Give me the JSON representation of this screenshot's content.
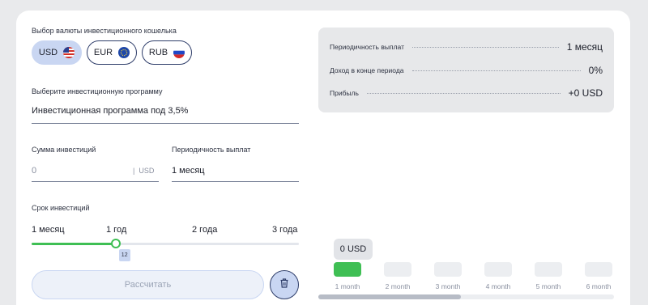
{
  "currency": {
    "label": "Выбор валюты инвестиционного кошелька",
    "options": [
      {
        "code": "USD",
        "flag": "us-flag-icon",
        "selected": true
      },
      {
        "code": "EUR",
        "flag": "eu-flag-icon",
        "selected": false
      },
      {
        "code": "RUB",
        "flag": "ru-flag-icon",
        "selected": false
      }
    ]
  },
  "program": {
    "label": "Выберите инвестиционную программу",
    "value": "Инвестиционная программа под 3,5%"
  },
  "amount": {
    "label": "Сумма инвестиций",
    "placeholder": "0",
    "unit": "USD"
  },
  "payout": {
    "label": "Периодичность выплат",
    "value": "1 месяц"
  },
  "term": {
    "label": "Срок инвестиций",
    "marks": [
      "1 месяц",
      "1 год",
      "2 года",
      "3 года"
    ],
    "value_months": 12,
    "max_months": 36,
    "badge": "12"
  },
  "calculate_label": "Рассчитать",
  "summary": [
    {
      "key": "Периодичность выплат",
      "value": "1 месяц"
    },
    {
      "key": "Доход в конце периода",
      "value": "0%"
    },
    {
      "key": "Прибыль",
      "value": "+0 USD"
    }
  ],
  "chart": {
    "tooltip": "0 USD",
    "months": [
      "1 month",
      "2 month",
      "3 month",
      "4 month",
      "5 month",
      "6 month"
    ],
    "active_index": 0
  },
  "colors": {
    "accent_green": "#3fbf54",
    "accent_blue": "#c9d6f2",
    "dark_blue": "#2f3e6a"
  }
}
